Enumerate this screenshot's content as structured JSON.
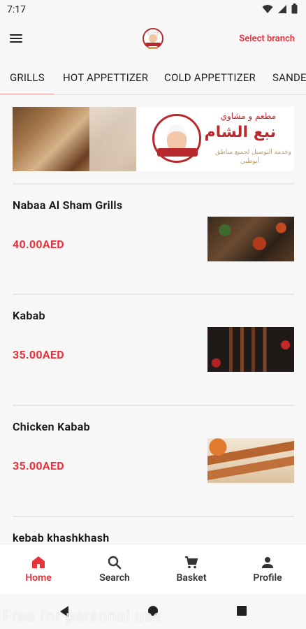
{
  "status_bar": {
    "time": "7:17"
  },
  "app_bar": {
    "select_branch_label": "Select branch"
  },
  "tabs": [
    {
      "label": "GRILLS"
    },
    {
      "label": "HOT APPETTIZER"
    },
    {
      "label": "COLD APPETTIZER"
    },
    {
      "label": "SANDE"
    }
  ],
  "banner": {
    "line1": "مطعم و مشاوي",
    "line2": "نبع الشام",
    "line3": "وخدمة التوصيل لجميع مناطق",
    "line4": "أبوظبي"
  },
  "menu_items": [
    {
      "name": "Nabaa Al Sham Grills",
      "price": "40.00AED"
    },
    {
      "name": "Kabab",
      "price": "35.00AED"
    },
    {
      "name": "Chicken Kabab",
      "price": "35.00AED"
    },
    {
      "name": "kebab khashkhash",
      "price": ""
    }
  ],
  "bottom_nav": [
    {
      "label": "Home",
      "icon": "home-icon",
      "active": true
    },
    {
      "label": "Search",
      "icon": "search-icon",
      "active": false
    },
    {
      "label": "Basket",
      "icon": "cart-icon",
      "active": false
    },
    {
      "label": "Profile",
      "icon": "person-icon",
      "active": false
    }
  ],
  "watermark": "Free for personal use",
  "colors": {
    "accent": "#e8323c",
    "tab_underline": "#e2a2a8",
    "background": "#f7f7f7"
  }
}
